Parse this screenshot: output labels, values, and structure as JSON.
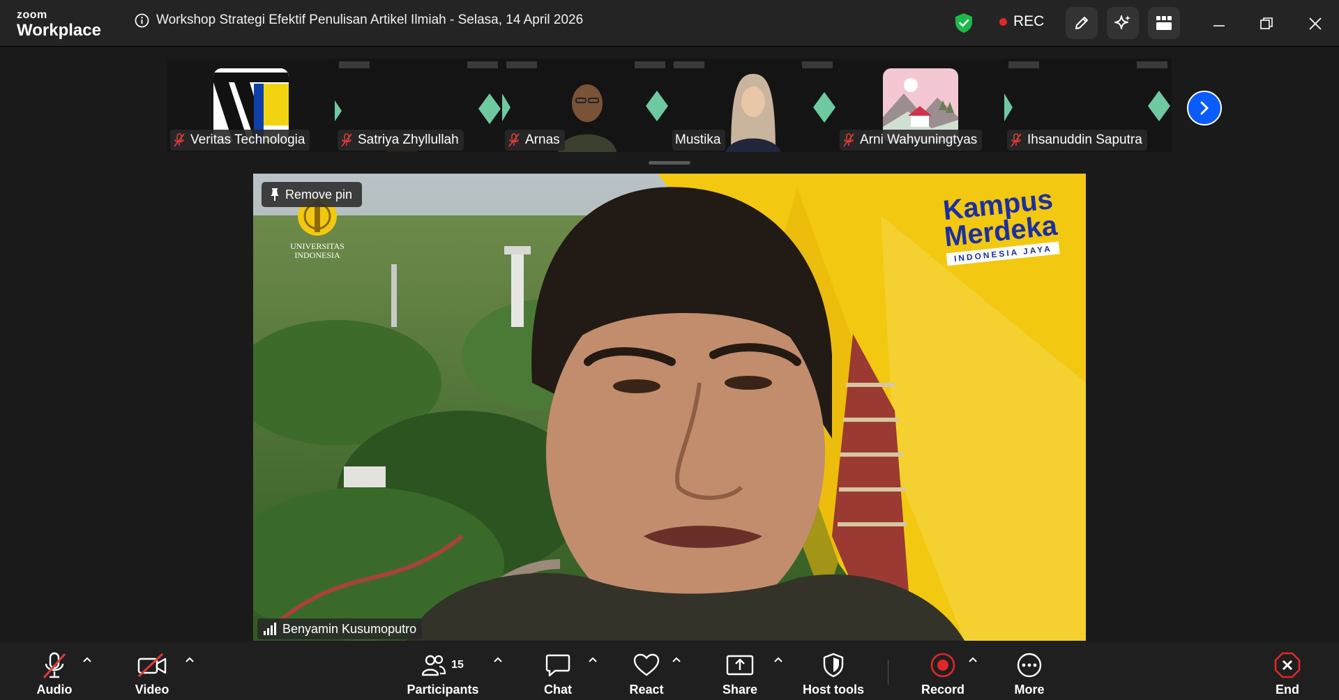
{
  "app": {
    "logo_line1": "zoom",
    "logo_line2": "Workplace"
  },
  "meeting": {
    "title": "Workshop Strategi Efektif Penulisan Artikel Ilmiah - Selasa, 14 April 2026",
    "rec_label": "REC"
  },
  "thumbnails": [
    {
      "name": "Veritas Technologia",
      "muted": true,
      "type": "logo"
    },
    {
      "name": "Satriya Zhyllullah",
      "muted": true,
      "type": "video"
    },
    {
      "name": "Arnas",
      "muted": true,
      "type": "video"
    },
    {
      "name": "Mustika",
      "muted": false,
      "type": "video"
    },
    {
      "name": "Arni Wahyuningtyas",
      "muted": true,
      "type": "avatar"
    },
    {
      "name": "Ihsanuddin Saputra",
      "muted": true,
      "type": "video"
    }
  ],
  "main_video": {
    "remove_pin_label": "Remove pin",
    "speaker_name": "Benyamin Kusumoputro",
    "bg_logo_line1": "UNIVERSITAS",
    "bg_logo_line2": "INDONESIA",
    "bg_brand_line1": "Kampus",
    "bg_brand_line2": "Merdeka",
    "bg_brand_line3": "INDONESIA JAYA"
  },
  "toolbar": {
    "audio": "Audio",
    "video": "Video",
    "participants": "Participants",
    "participants_count": "15",
    "chat": "Chat",
    "react": "React",
    "share": "Share",
    "host_tools": "Host tools",
    "record": "Record",
    "more": "More",
    "end": "End"
  },
  "colors": {
    "accent": "#0b5cff",
    "record_red": "#e02828",
    "shield_green": "#1fb84c",
    "brand_yellow": "#f2c811"
  }
}
